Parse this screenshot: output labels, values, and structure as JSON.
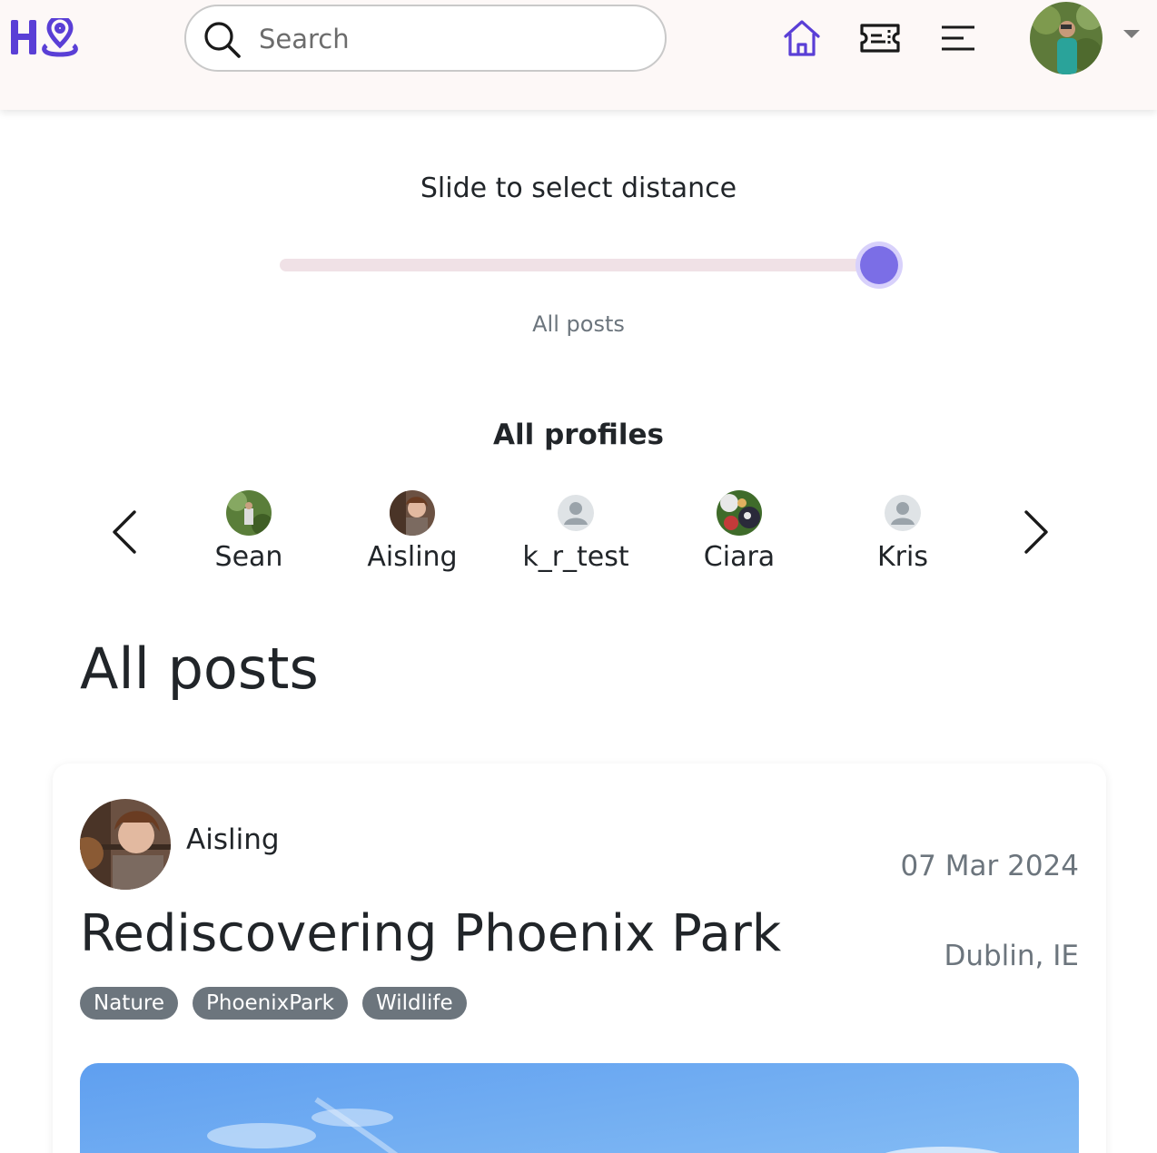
{
  "header": {
    "logo_text": "H",
    "search": {
      "placeholder": "Search",
      "value": ""
    },
    "nav": [
      {
        "icon": "home-icon",
        "active": true
      },
      {
        "icon": "ticket-icon",
        "active": false
      },
      {
        "icon": "menu-icon",
        "active": false
      }
    ],
    "account_menu_icon": "caret-down-icon"
  },
  "distance": {
    "title": "Slide to select distance",
    "value_label": "All posts",
    "slider_level": 1.0
  },
  "profiles": {
    "title": "All profiles",
    "items": [
      {
        "name": "Sean",
        "avatar": "photo"
      },
      {
        "name": "Aisling",
        "avatar": "photo"
      },
      {
        "name": "k_r_test",
        "avatar": "default-avatar-icon"
      },
      {
        "name": "Ciara",
        "avatar": "photo"
      },
      {
        "name": "Kris",
        "avatar": "default-avatar-icon"
      }
    ],
    "prev_icon": "chevron-left-icon",
    "next_icon": "chevron-right-icon"
  },
  "posts": {
    "heading": "All posts",
    "items": [
      {
        "author": "Aisling",
        "date": "07 Mar 2024",
        "title": "Rediscovering Phoenix Park",
        "location": "Dublin, IE",
        "tags": [
          "Nature",
          "PhoenixPark",
          "Wildlife"
        ]
      }
    ]
  },
  "colors": {
    "brand": "#5a3fd6",
    "header_bg": "#fdf8f7",
    "slider_thumb": "#7b6ee6",
    "slider_track": "#f0e1e6",
    "tag_bg": "#6c757d",
    "muted_text": "#6c757d"
  }
}
